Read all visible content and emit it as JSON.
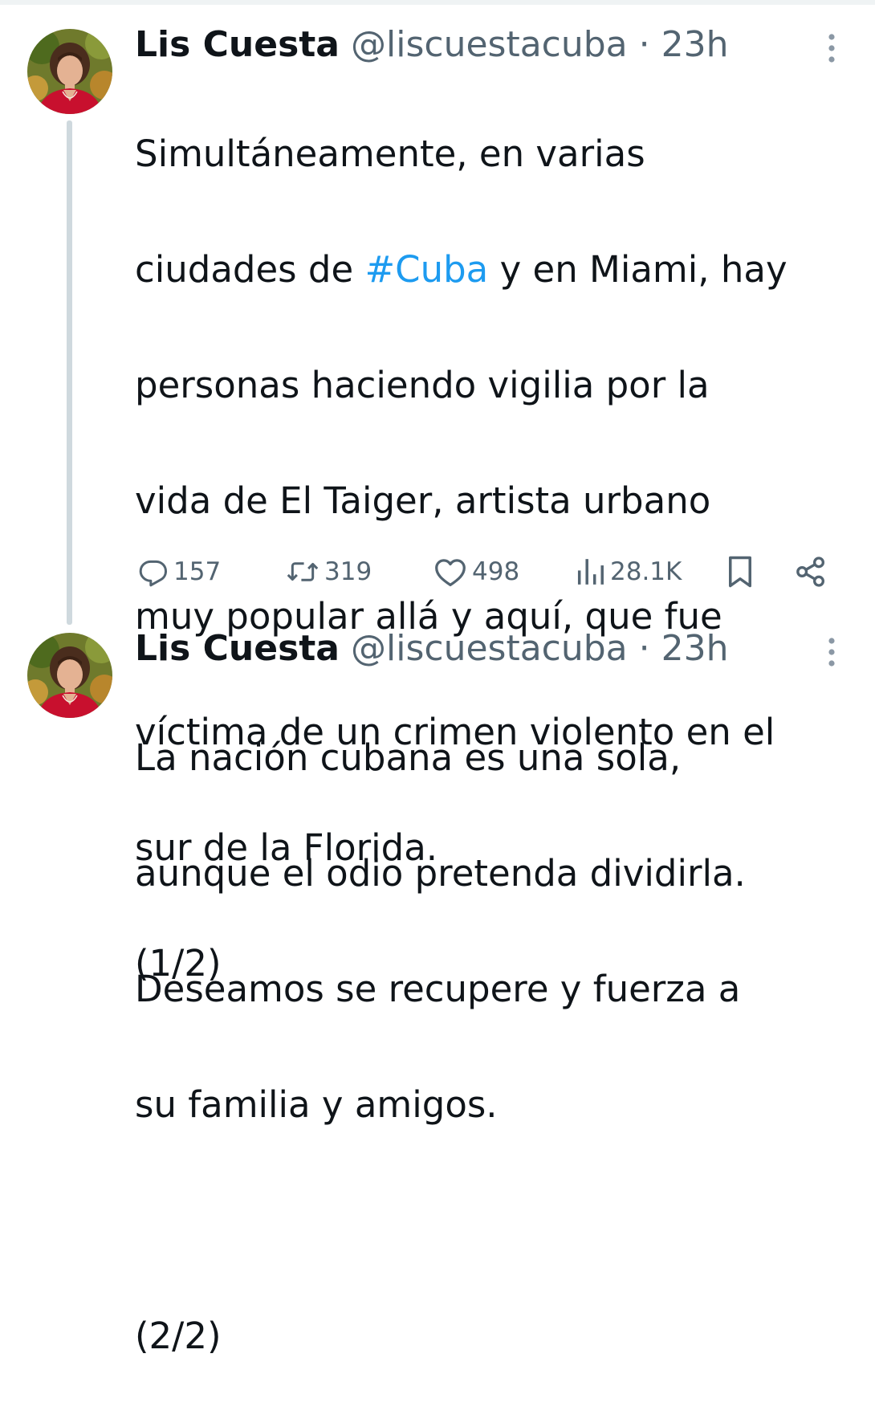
{
  "tweets": [
    {
      "author": {
        "name": "Lis Cuesta",
        "handle": "@liscuestacuba"
      },
      "separator": "·",
      "time": "23h",
      "text_lines": [
        [
          "Simultáneamente, en varias"
        ],
        [
          "ciudades de ",
          "#Cuba",
          " y en Miami, hay"
        ],
        [
          "personas haciendo vigilia por la"
        ],
        [
          "vida de El Taiger, artista urbano"
        ],
        [
          "muy popular allá y aquí, que fue"
        ],
        [
          "víctima de un crimen violento en el"
        ],
        [
          "sur de la Florida."
        ],
        [
          "(1/2)"
        ]
      ],
      "hashtag": "#Cuba",
      "stats": {
        "replies": "157",
        "reposts": "319",
        "likes": "498",
        "views": "28.1K"
      }
    },
    {
      "author": {
        "name": "Lis Cuesta",
        "handle": "@liscuestacuba"
      },
      "separator": "·",
      "time": "23h",
      "text_lines": [
        [
          "La nación cubana es una sola,"
        ],
        [
          "aunque el odio pretenda dividirla."
        ],
        [
          "Deseamos se recupere y fuerza a"
        ],
        [
          "su familia y amigos."
        ],
        [
          ""
        ],
        [
          "(2/2)"
        ]
      ]
    }
  ],
  "icons": {
    "reply": "reply-icon",
    "repost": "repost-icon",
    "like": "like-icon",
    "views": "views-icon",
    "bookmark": "bookmark-icon",
    "share": "share-icon",
    "more": "more-vertical-icon"
  },
  "colors": {
    "text": "#0f1419",
    "secondary": "#536471",
    "hashtag": "#1d9bf0",
    "thread_line": "#cfd9de"
  }
}
